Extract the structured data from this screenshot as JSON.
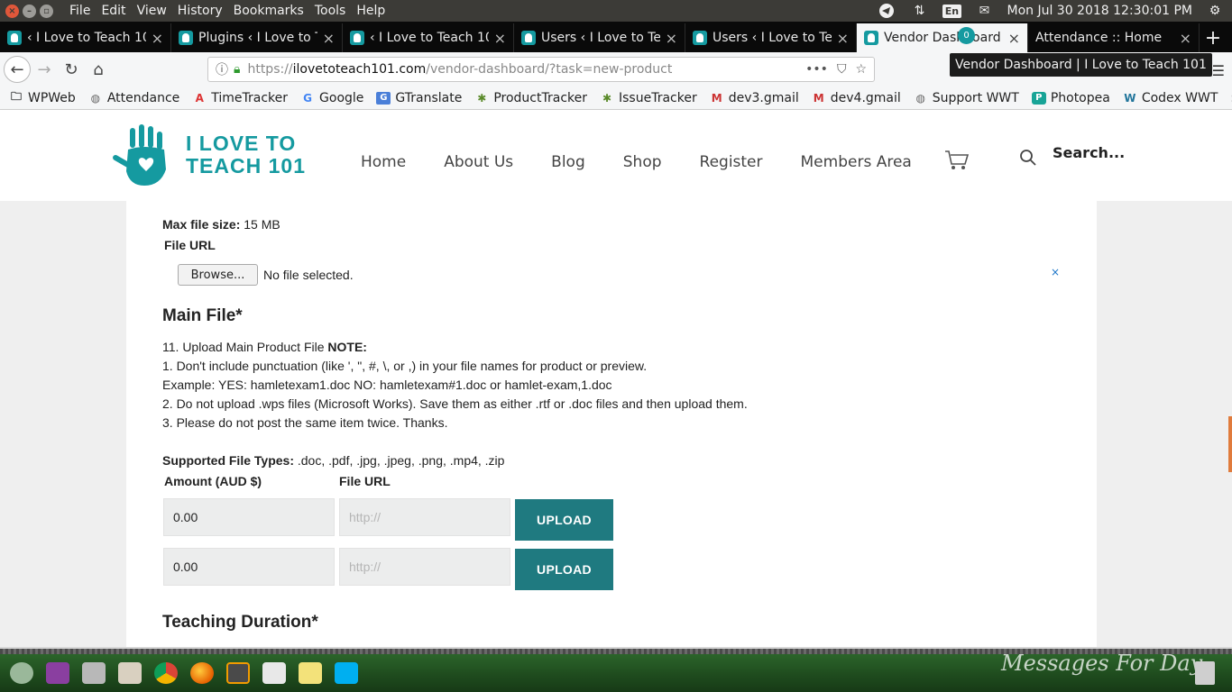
{
  "os": {
    "menu": [
      "File",
      "Edit",
      "View",
      "History",
      "Bookmarks",
      "Tools",
      "Help"
    ],
    "lang": "En",
    "clock": "Mon Jul 30 2018 12:30:01 PM"
  },
  "tabs": [
    {
      "label": "‹ I Love to Teach 10",
      "active": false
    },
    {
      "label": "Plugins ‹ I Love to T",
      "active": false
    },
    {
      "label": "‹ I Love to Teach 10",
      "active": false
    },
    {
      "label": "Users ‹ I Love to Te",
      "active": false
    },
    {
      "label": "Users ‹ I Love to Te",
      "active": false
    },
    {
      "label": "Vendor Dashboard",
      "active": true
    },
    {
      "label": "Attendance :: Home",
      "active": false
    }
  ],
  "url": {
    "scheme": "https://",
    "host": "ilovetoteach101.com",
    "path": "/vendor-dashboard/?task=new-product"
  },
  "tooltip": "Vendor Dashboard | I Love to Teach 101",
  "bookmarks": [
    {
      "label": "WPWeb",
      "icon": "folder-icon"
    },
    {
      "label": "Attendance",
      "icon": "globe-icon"
    },
    {
      "label": "TimeTracker",
      "icon": "timetracker-icon"
    },
    {
      "label": "Google",
      "icon": "google-icon"
    },
    {
      "label": "GTranslate",
      "icon": "translate-icon"
    },
    {
      "label": "ProductTracker",
      "icon": "bug-icon"
    },
    {
      "label": "IssueTracker",
      "icon": "bug-icon"
    },
    {
      "label": "dev3.gmail",
      "icon": "gmail-icon"
    },
    {
      "label": "dev4.gmail",
      "icon": "gmail-icon"
    },
    {
      "label": "Support WWT",
      "icon": "globe-icon"
    },
    {
      "label": "Photopea",
      "icon": "photopea-icon"
    },
    {
      "label": "Codex WWT",
      "icon": "wordpress-icon"
    }
  ],
  "site": {
    "logo_line1": "I LOVE TO",
    "logo_line2": "TEACH 101",
    "nav": [
      "Home",
      "About Us",
      "Blog",
      "Shop",
      "Register",
      "Members Area"
    ],
    "cart_count": "0",
    "search_label": "Search..."
  },
  "form": {
    "max_file_label": "Max file size:",
    "max_file_value": "15 MB",
    "file_url_label": "File URL",
    "browse_label": "Browse...",
    "no_file": "No file selected.",
    "close_x": "×",
    "main_file_heading": "Main File*",
    "instructions_title": "11. Upload Main Product File",
    "note": "NOTE:",
    "instructions": [
      "1. Don't include punctuation (like ', \", #, \\, or ,) in your file names for product or preview.",
      "Example: YES: hamletexam1.doc NO: hamletexam#1.doc or hamlet-exam,1.doc",
      "2. Do not upload .wps files (Microsoft Works). Save them as either .rtf or .doc files and then upload them.",
      "3. Please do not post the same item twice. Thanks."
    ],
    "supported_label": "Supported File Types:",
    "supported_value": ".doc, .pdf, .jpg, .jpeg, .png, .mp4, .zip",
    "amount_header": "Amount (AUD $)",
    "file_url_header": "File URL",
    "rows": [
      {
        "amount": "0.00",
        "url_placeholder": "http://",
        "button": "UPLOAD"
      },
      {
        "amount": "0.00",
        "url_placeholder": "http://",
        "button": "UPLOAD"
      }
    ],
    "teaching_heading": "Teaching Duration*"
  },
  "taskbar": {
    "message": "Messages For Day"
  },
  "colors": {
    "brand": "#159aa0",
    "upload_button": "#1f7a80",
    "os_bar": "#3c3b37"
  }
}
